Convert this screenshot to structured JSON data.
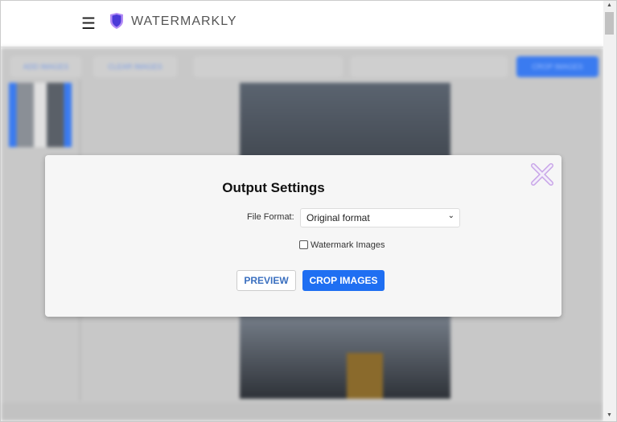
{
  "header": {
    "menu_icon": "hamburger-icon",
    "logo_icon": "shield-icon",
    "brand": "WATERMARKLY"
  },
  "toolbar": {
    "add": "ADD IMAGES",
    "clear": "CLEAR IMAGES",
    "crop": "CROP IMAGES"
  },
  "modal": {
    "title": "Output Settings",
    "file_format_label": "File Format:",
    "file_format_value": "Original format",
    "watermark_label": "Watermark Images",
    "watermark_checked": false,
    "preview": "PREVIEW",
    "crop": "CROP IMAGES",
    "close_icon": "close-icon"
  },
  "colors": {
    "accent": "#1f6ff2",
    "logo": "#6a4cf0"
  }
}
